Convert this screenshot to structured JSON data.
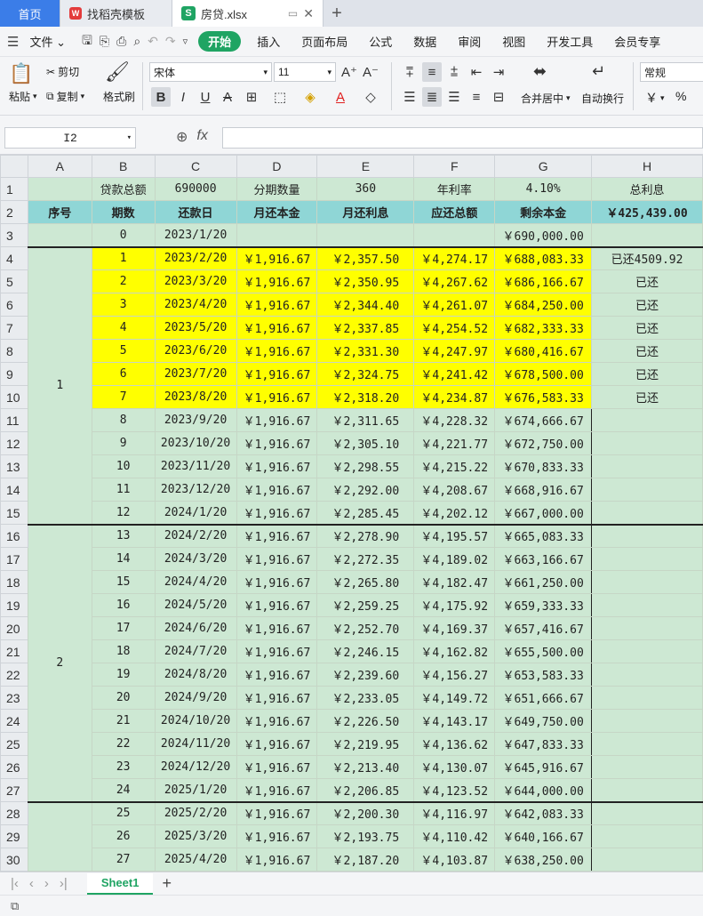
{
  "tabs": {
    "home": "首页",
    "template": "找稻壳模板",
    "file": "房贷.xlsx"
  },
  "menu": {
    "file": "文件",
    "items": [
      "开始",
      "插入",
      "页面布局",
      "公式",
      "数据",
      "审阅",
      "视图",
      "开发工具",
      "会员专享"
    ]
  },
  "ribbon": {
    "paste": "粘贴",
    "cut": "剪切",
    "copy": "复制",
    "format_painter": "格式刷",
    "font_name": "宋体",
    "font_size": "11",
    "number_format": "常规",
    "merge_center": "合并居中",
    "wrap_text": "自动换行",
    "currency": "￥",
    "percent": "%"
  },
  "formula_bar": {
    "cell_ref": "I2",
    "fx": "fx",
    "content": ""
  },
  "columns": [
    "A",
    "B",
    "C",
    "D",
    "E",
    "F",
    "G",
    "H"
  ],
  "row1": {
    "b": "贷款总额",
    "c": "690000",
    "d": "分期数量",
    "e": "360",
    "f": "年利率",
    "g": "4.10%",
    "h": "总利息"
  },
  "row2": {
    "a": "序号",
    "b": "期数",
    "c": "还款日",
    "d": "月还本金",
    "e": "月还利息",
    "f": "应还总额",
    "g": "剩余本金",
    "h": "￥425,439.00"
  },
  "row3": {
    "b": "0",
    "c": "2023/1/20",
    "g": "￥690,000.00"
  },
  "year_labels": [
    "1",
    "2"
  ],
  "rows": [
    {
      "n": "4",
      "b": "1",
      "c": "2023/2/20",
      "d": "￥1,916.67",
      "e": "￥2,357.50",
      "f": "￥4,274.17",
      "g": "￥688,083.33",
      "h": "已还4509.92"
    },
    {
      "n": "5",
      "b": "2",
      "c": "2023/3/20",
      "d": "￥1,916.67",
      "e": "￥2,350.95",
      "f": "￥4,267.62",
      "g": "￥686,166.67",
      "h": "已还"
    },
    {
      "n": "6",
      "b": "3",
      "c": "2023/4/20",
      "d": "￥1,916.67",
      "e": "￥2,344.40",
      "f": "￥4,261.07",
      "g": "￥684,250.00",
      "h": "已还"
    },
    {
      "n": "7",
      "b": "4",
      "c": "2023/5/20",
      "d": "￥1,916.67",
      "e": "￥2,337.85",
      "f": "￥4,254.52",
      "g": "￥682,333.33",
      "h": "已还"
    },
    {
      "n": "8",
      "b": "5",
      "c": "2023/6/20",
      "d": "￥1,916.67",
      "e": "￥2,331.30",
      "f": "￥4,247.97",
      "g": "￥680,416.67",
      "h": "已还"
    },
    {
      "n": "9",
      "b": "6",
      "c": "2023/7/20",
      "d": "￥1,916.67",
      "e": "￥2,324.75",
      "f": "￥4,241.42",
      "g": "￥678,500.00",
      "h": "已还"
    },
    {
      "n": "10",
      "b": "7",
      "c": "2023/8/20",
      "d": "￥1,916.67",
      "e": "￥2,318.20",
      "f": "￥4,234.87",
      "g": "￥676,583.33",
      "h": "已还"
    },
    {
      "n": "11",
      "b": "8",
      "c": "2023/9/20",
      "d": "￥1,916.67",
      "e": "￥2,311.65",
      "f": "￥4,228.32",
      "g": "￥674,666.67",
      "h": ""
    },
    {
      "n": "12",
      "b": "9",
      "c": "2023/10/20",
      "d": "￥1,916.67",
      "e": "￥2,305.10",
      "f": "￥4,221.77",
      "g": "￥672,750.00",
      "h": ""
    },
    {
      "n": "13",
      "b": "10",
      "c": "2023/11/20",
      "d": "￥1,916.67",
      "e": "￥2,298.55",
      "f": "￥4,215.22",
      "g": "￥670,833.33",
      "h": ""
    },
    {
      "n": "14",
      "b": "11",
      "c": "2023/12/20",
      "d": "￥1,916.67",
      "e": "￥2,292.00",
      "f": "￥4,208.67",
      "g": "￥668,916.67",
      "h": ""
    },
    {
      "n": "15",
      "b": "12",
      "c": "2024/1/20",
      "d": "￥1,916.67",
      "e": "￥2,285.45",
      "f": "￥4,202.12",
      "g": "￥667,000.00",
      "h": ""
    },
    {
      "n": "16",
      "b": "13",
      "c": "2024/2/20",
      "d": "￥1,916.67",
      "e": "￥2,278.90",
      "f": "￥4,195.57",
      "g": "￥665,083.33",
      "h": ""
    },
    {
      "n": "17",
      "b": "14",
      "c": "2024/3/20",
      "d": "￥1,916.67",
      "e": "￥2,272.35",
      "f": "￥4,189.02",
      "g": "￥663,166.67",
      "h": ""
    },
    {
      "n": "18",
      "b": "15",
      "c": "2024/4/20",
      "d": "￥1,916.67",
      "e": "￥2,265.80",
      "f": "￥4,182.47",
      "g": "￥661,250.00",
      "h": ""
    },
    {
      "n": "19",
      "b": "16",
      "c": "2024/5/20",
      "d": "￥1,916.67",
      "e": "￥2,259.25",
      "f": "￥4,175.92",
      "g": "￥659,333.33",
      "h": ""
    },
    {
      "n": "20",
      "b": "17",
      "c": "2024/6/20",
      "d": "￥1,916.67",
      "e": "￥2,252.70",
      "f": "￥4,169.37",
      "g": "￥657,416.67",
      "h": ""
    },
    {
      "n": "21",
      "b": "18",
      "c": "2024/7/20",
      "d": "￥1,916.67",
      "e": "￥2,246.15",
      "f": "￥4,162.82",
      "g": "￥655,500.00",
      "h": ""
    },
    {
      "n": "22",
      "b": "19",
      "c": "2024/8/20",
      "d": "￥1,916.67",
      "e": "￥2,239.60",
      "f": "￥4,156.27",
      "g": "￥653,583.33",
      "h": ""
    },
    {
      "n": "23",
      "b": "20",
      "c": "2024/9/20",
      "d": "￥1,916.67",
      "e": "￥2,233.05",
      "f": "￥4,149.72",
      "g": "￥651,666.67",
      "h": ""
    },
    {
      "n": "24",
      "b": "21",
      "c": "2024/10/20",
      "d": "￥1,916.67",
      "e": "￥2,226.50",
      "f": "￥4,143.17",
      "g": "￥649,750.00",
      "h": ""
    },
    {
      "n": "25",
      "b": "22",
      "c": "2024/11/20",
      "d": "￥1,916.67",
      "e": "￥2,219.95",
      "f": "￥4,136.62",
      "g": "￥647,833.33",
      "h": ""
    },
    {
      "n": "26",
      "b": "23",
      "c": "2024/12/20",
      "d": "￥1,916.67",
      "e": "￥2,213.40",
      "f": "￥4,130.07",
      "g": "￥645,916.67",
      "h": ""
    },
    {
      "n": "27",
      "b": "24",
      "c": "2025/1/20",
      "d": "￥1,916.67",
      "e": "￥2,206.85",
      "f": "￥4,123.52",
      "g": "￥644,000.00",
      "h": ""
    },
    {
      "n": "28",
      "b": "25",
      "c": "2025/2/20",
      "d": "￥1,916.67",
      "e": "￥2,200.30",
      "f": "￥4,116.97",
      "g": "￥642,083.33",
      "h": ""
    },
    {
      "n": "29",
      "b": "26",
      "c": "2025/3/20",
      "d": "￥1,916.67",
      "e": "￥2,193.75",
      "f": "￥4,110.42",
      "g": "￥640,166.67",
      "h": ""
    },
    {
      "n": "30",
      "b": "27",
      "c": "2025/4/20",
      "d": "￥1,916.67",
      "e": "￥2,187.20",
      "f": "￥4,103.87",
      "g": "￥638,250.00",
      "h": ""
    }
  ],
  "sheet_tab": "Sheet1",
  "colors": {
    "accent": "#1fa463",
    "header_fill": "#8fd6d6",
    "cell_fill": "#cde8d3",
    "paid_fill": "#ffff00"
  }
}
